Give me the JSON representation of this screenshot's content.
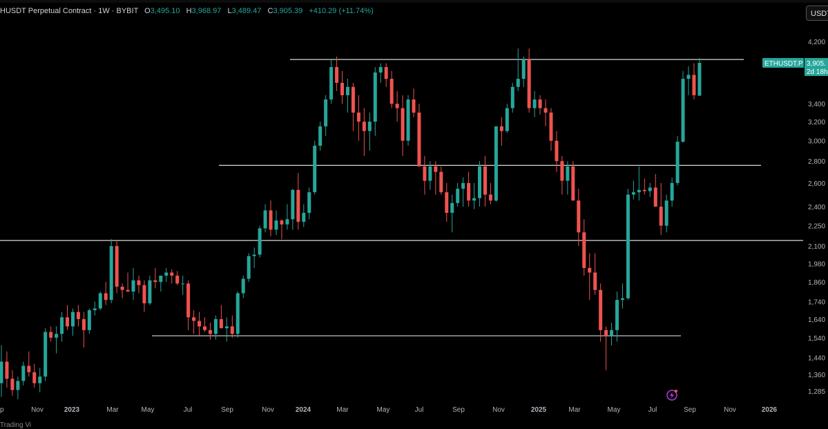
{
  "header": {
    "symbol": "HUSDT Perpetual Contract · 1W · BYBIT",
    "o_label": "O",
    "o_value": "3,495.10",
    "h_label": "H",
    "h_value": "3,968.97",
    "l_label": "L",
    "l_value": "3,489.47",
    "c_label": "C",
    "c_value": "3,905.39",
    "change": "+410.29 (+11.74%)"
  },
  "currency_button": "USDT",
  "price_tag": {
    "symbol": "ETHUSDT.P",
    "price": "3,905.",
    "countdown": "2d 18h"
  },
  "footer": "Trading Vi",
  "colors": {
    "up": "#26a69a",
    "down": "#ef5350",
    "background": "#000000",
    "level_line": "#d9d9d9"
  },
  "chart_data": {
    "type": "candlestick",
    "x_axis_labels": [
      "p",
      "Nov",
      "2023",
      "Mar",
      "May",
      "Jul",
      "Sep",
      "Nov",
      "2024",
      "Mar",
      "May",
      "Jul",
      "Sep",
      "Nov",
      "2025",
      "Mar",
      "May",
      "Jul",
      "Sep",
      "Nov",
      "2026"
    ],
    "y_axis_labels": [
      "4,200",
      "3,400",
      "3,200",
      "3,000",
      "2,800",
      "2,600",
      "2,400",
      "2,250",
      "2,100",
      "1,980",
      "1,860",
      "1,740",
      "1,640",
      "1,540",
      "1,440",
      "1,360",
      "1,285"
    ],
    "y_scale": "log",
    "ylim": [
      1250,
      4400
    ],
    "horizontal_levels": [
      3950,
      2760,
      2140,
      1550
    ],
    "candles": [
      [
        1320,
        1500,
        1260,
        1420
      ],
      [
        1420,
        1470,
        1300,
        1340
      ],
      [
        1340,
        1380,
        1265,
        1290
      ],
      [
        1290,
        1350,
        1250,
        1330
      ],
      [
        1330,
        1420,
        1310,
        1400
      ],
      [
        1400,
        1470,
        1350,
        1370
      ],
      [
        1370,
        1410,
        1300,
        1320
      ],
      [
        1320,
        1390,
        1280,
        1350
      ],
      [
        1350,
        1590,
        1330,
        1570
      ],
      [
        1570,
        1600,
        1520,
        1540
      ],
      [
        1540,
        1600,
        1460,
        1560
      ],
      [
        1560,
        1680,
        1520,
        1650
      ],
      [
        1650,
        1720,
        1580,
        1600
      ],
      [
        1600,
        1700,
        1550,
        1680
      ],
      [
        1680,
        1720,
        1600,
        1640
      ],
      [
        1640,
        1680,
        1490,
        1580
      ],
      [
        1580,
        1700,
        1560,
        1690
      ],
      [
        1690,
        1740,
        1660,
        1700
      ],
      [
        1700,
        1800,
        1690,
        1790
      ],
      [
        1790,
        1860,
        1720,
        1750
      ],
      [
        1750,
        2150,
        1730,
        2100
      ],
      [
        2100,
        2140,
        1790,
        1830
      ],
      [
        1830,
        1850,
        1760,
        1810
      ],
      [
        1810,
        1920,
        1800,
        1800
      ],
      [
        1800,
        1950,
        1750,
        1870
      ],
      [
        1870,
        1900,
        1790,
        1840
      ],
      [
        1840,
        1870,
        1680,
        1730
      ],
      [
        1730,
        1900,
        1720,
        1870
      ],
      [
        1870,
        1950,
        1820,
        1860
      ],
      [
        1860,
        1900,
        1800,
        1900
      ],
      [
        1900,
        1950,
        1860,
        1920
      ],
      [
        1920,
        1940,
        1850,
        1900
      ],
      [
        1900,
        1930,
        1840,
        1850
      ],
      [
        1850,
        1900,
        1780,
        1850
      ],
      [
        1850,
        1870,
        1580,
        1650
      ],
      [
        1650,
        1690,
        1560,
        1630
      ],
      [
        1630,
        1680,
        1550,
        1600
      ],
      [
        1600,
        1650,
        1570,
        1580
      ],
      [
        1580,
        1620,
        1530,
        1560
      ],
      [
        1560,
        1660,
        1530,
        1640
      ],
      [
        1640,
        1720,
        1620,
        1590
      ],
      [
        1590,
        1650,
        1520,
        1600
      ],
      [
        1600,
        1660,
        1540,
        1560
      ],
      [
        1560,
        1800,
        1540,
        1790
      ],
      [
        1790,
        1900,
        1760,
        1880
      ],
      [
        1880,
        2050,
        1860,
        2030
      ],
      [
        2030,
        2090,
        1950,
        2040
      ],
      [
        2040,
        2250,
        2020,
        2230
      ],
      [
        2230,
        2420,
        2200,
        2370
      ],
      [
        2370,
        2450,
        2170,
        2220
      ],
      [
        2220,
        2370,
        2180,
        2290
      ],
      [
        2290,
        2300,
        2150,
        2260
      ],
      [
        2260,
        2420,
        2220,
        2300
      ],
      [
        2300,
        2550,
        2220,
        2540
      ],
      [
        2540,
        2690,
        2220,
        2280
      ],
      [
        2280,
        2420,
        2240,
        2350
      ],
      [
        2350,
        2560,
        2300,
        2520
      ],
      [
        2520,
        3000,
        2500,
        2950
      ],
      [
        2950,
        3200,
        2900,
        3150
      ],
      [
        3150,
        3500,
        3050,
        3450
      ],
      [
        3450,
        3950,
        3400,
        3850
      ],
      [
        3850,
        3990,
        3550,
        3650
      ],
      [
        3650,
        3800,
        3400,
        3500
      ],
      [
        3500,
        3700,
        3300,
        3600
      ],
      [
        3600,
        3650,
        3100,
        3300
      ],
      [
        3300,
        3500,
        3000,
        3200
      ],
      [
        3200,
        3350,
        2850,
        3100
      ],
      [
        3100,
        3300,
        2900,
        3200
      ],
      [
        3200,
        3850,
        3050,
        3780
      ],
      [
        3780,
        3900,
        3650,
        3850
      ],
      [
        3850,
        3900,
        3600,
        3700
      ],
      [
        3700,
        3800,
        3350,
        3400
      ],
      [
        3400,
        3550,
        3200,
        3350
      ],
      [
        3350,
        3500,
        2850,
        3000
      ],
      [
        3000,
        3500,
        2950,
        3450
      ],
      [
        3450,
        3580,
        3250,
        3300
      ],
      [
        3300,
        3400,
        2800,
        2750
      ],
      [
        2750,
        2850,
        2500,
        2620
      ],
      [
        2620,
        2800,
        2540,
        2750
      ],
      [
        2750,
        2800,
        2500,
        2700
      ],
      [
        2700,
        2750,
        2500,
        2520
      ],
      [
        2520,
        2600,
        2280,
        2350
      ],
      [
        2350,
        2500,
        2200,
        2430
      ],
      [
        2430,
        2600,
        2400,
        2550
      ],
      [
        2550,
        2650,
        2400,
        2600
      ],
      [
        2600,
        2700,
        2400,
        2450
      ],
      [
        2450,
        2600,
        2380,
        2470
      ],
      [
        2470,
        2800,
        2400,
        2750
      ],
      [
        2750,
        2850,
        2400,
        2500
      ],
      [
        2500,
        2600,
        2420,
        2450
      ],
      [
        2450,
        3000,
        2440,
        3150
      ],
      [
        3150,
        3250,
        2950,
        3100
      ],
      [
        3100,
        3400,
        3080,
        3350
      ],
      [
        3350,
        3650,
        3300,
        3600
      ],
      [
        3600,
        4100,
        3550,
        3700
      ],
      [
        3700,
        3990,
        3600,
        3950
      ],
      [
        3950,
        4100,
        3300,
        3350
      ],
      [
        3350,
        3550,
        3250,
        3450
      ],
      [
        3450,
        3500,
        3280,
        3350
      ],
      [
        3350,
        3450,
        3150,
        3300
      ],
      [
        3300,
        3350,
        2900,
        3000
      ],
      [
        3000,
        3100,
        2700,
        2800
      ],
      [
        2800,
        2850,
        2500,
        2620
      ],
      [
        2620,
        2800,
        2500,
        2750
      ],
      [
        2750,
        2800,
        2450,
        2450
      ],
      [
        2450,
        2550,
        2100,
        2200
      ],
      [
        2200,
        2300,
        1900,
        1950
      ],
      [
        1950,
        2050,
        1750,
        1920
      ],
      [
        1920,
        2050,
        1780,
        1810
      ],
      [
        1810,
        1850,
        1520,
        1580
      ],
      [
        1580,
        1600,
        1380,
        1550
      ],
      [
        1550,
        1620,
        1500,
        1580
      ],
      [
        1580,
        1800,
        1520,
        1750
      ],
      [
        1750,
        1850,
        1700,
        1760
      ],
      [
        1760,
        2550,
        1750,
        2500
      ],
      [
        2500,
        2620,
        2460,
        2520
      ],
      [
        2520,
        2750,
        2450,
        2540
      ],
      [
        2540,
        2640,
        2500,
        2530
      ],
      [
        2530,
        2600,
        2480,
        2560
      ],
      [
        2560,
        2680,
        2450,
        2400
      ],
      [
        2400,
        2600,
        2180,
        2250
      ],
      [
        2250,
        2500,
        2200,
        2450
      ],
      [
        2450,
        2650,
        2400,
        2600
      ],
      [
        2600,
        3050,
        2580,
        2990
      ],
      [
        2990,
        3800,
        2980,
        3700
      ],
      [
        3700,
        3860,
        3500,
        3750
      ],
      [
        3750,
        3900,
        3450,
        3500
      ],
      [
        3495.1,
        3968.97,
        3489.47,
        3905.39
      ]
    ]
  }
}
